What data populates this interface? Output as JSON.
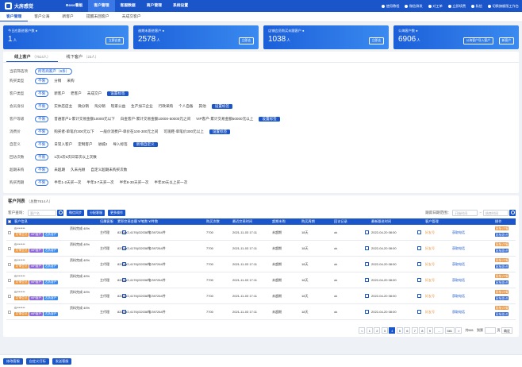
{
  "app": {
    "title": "大房感觉"
  },
  "nav": {
    "items": [
      "Boss看板",
      "客户管理",
      "客服数据",
      "商户管理",
      "系统设置"
    ]
  },
  "topright": {
    "items": [
      "使用教程",
      "微信群发",
      "对工单",
      "立即续费",
      "私信",
      "切换旗舰版工作台"
    ]
  },
  "subtabs": [
    "客户管理",
    "客户公海",
    "新客户",
    "提醒未回客户",
    "未成交客户"
  ],
  "stats": [
    {
      "label": "今日应跟进客户数 ●",
      "value": "1",
      "unit": "人",
      "button": "立即去查"
    },
    {
      "label": "逾期未跟进客户 ●",
      "value": "2578",
      "unit": "人",
      "button": "立即去"
    },
    {
      "label": "店铺会员购买未跟客户 ●",
      "value": "1038",
      "unit": "人",
      "button": "立即去"
    },
    {
      "label": "公海客户数 ●",
      "value": "6906",
      "unit": "人",
      "button": "公海客户导入客户",
      "button2": "新客户"
    }
  ],
  "filter": {
    "tabs": [
      {
        "label": "线上客户",
        "count": "（7614人）"
      },
      {
        "label": "线下客户",
        "count": "（23人）"
      }
    ],
    "rows": [
      {
        "key": "当前筛选项",
        "opts": [
          "所有商家产（6条）"
        ]
      },
      {
        "key": "购买类型",
        "opts": [
          "不限",
          "分销",
          "采购"
        ]
      },
      {
        "key": "客户类型",
        "opts": [
          "不限",
          "新客户",
          "老客户",
          "未成交户",
          "设置标签"
        ]
      },
      {
        "key": "会员身份",
        "opts": [
          "不限",
          "实体店店主",
          "微分销",
          "淘分销",
          "现家公益",
          "生产加工企业",
          "行政采购",
          "个人自备",
          "其他",
          "设置标签"
        ]
      },
      {
        "key": "客户等级",
        "opts": [
          "不限",
          "普通客户1-累计交易金额10000元以下",
          "白金客户-累计交易金额10000-50000元之间",
          "VIP客户-累计交易金额50000元以上",
          "设置标签"
        ]
      },
      {
        "key": "消费价",
        "opts": [
          "不限",
          "购买者-单笔价300元以下",
          "一般价消费户-单价在100-300元之间",
          "可观鞋-单笔价300元以上",
          "设置标签"
        ]
      },
      {
        "key": "自定义",
        "opts": [
          "不限",
          "日常入客户",
          "定制客户",
          "进城2",
          "导入标签",
          "新增自定义"
        ]
      },
      {
        "key": "回访次数",
        "opts": [
          "不限",
          "1次3次5次日常次以上次数"
        ]
      },
      {
        "key": "超期未购",
        "opts": [
          "不限",
          "未超期",
          "久未光顾",
          "自定义超期未购买次数"
        ]
      },
      {
        "key": "购买周期",
        "opts": [
          "不限",
          "半年1-2天买一次",
          "半年3-7天买一次",
          "半年8-30天买一次",
          "半年30天以上买一次"
        ]
      }
    ]
  },
  "list": {
    "title": "客户列表",
    "count": "（总数7614人）",
    "search_label": "客户查询：",
    "search_placeholder": "客户名",
    "btn_sync": "微信同步",
    "btn_group": "分配客服",
    "btn_more": "更多操作",
    "date_label": "跟踪日期范围：",
    "date_from": "开始时间",
    "date_to": "结束时间",
    "columns": [
      "客户信息",
      "归属客服",
      "累积交易金额 ¥/笔数 ¥/件数",
      "购买次数",
      "最近交易时间",
      "超期未购",
      "购买周期",
      "回访记录",
      "最新跟进时间",
      "客户管理",
      "操作"
    ],
    "rows": [
      {
        "name": "S*******",
        "tags": [
          "店铺会员",
          "VIP客户",
          "活跃客户"
        ],
        "score": "资料完成 40%",
        "owner": "主代理",
        "amount": "8200(¥2,4176)/32038笔/397264件",
        "times": "7700",
        "last": "2021-11-03 17:11",
        "overdue": "未超期",
        "cycle": "18天",
        "visit": "ok",
        "follow": "2022-04-20 08:00",
        "wx": "好友号",
        "phone": "获取电话",
        "op1": "客服详情",
        "op2": "客服跟进"
      },
      {
        "name": "S*******",
        "tags": [
          "店铺会员",
          "VIP客户",
          "活跃客户"
        ],
        "score": "资料完成 40%",
        "owner": "主代理",
        "amount": "8200(¥2,4176)/32038笔/397264件",
        "times": "7700",
        "last": "2021-11-03 17:11",
        "overdue": "未超期",
        "cycle": "18天",
        "visit": "ok",
        "follow": "2022-04-20 08:00",
        "wx": "好友号",
        "phone": "获取电话",
        "op1": "客服详情",
        "op2": "客服跟进"
      },
      {
        "name": "S*******",
        "tags": [
          "店铺会员",
          "VIP客户",
          "活跃客户"
        ],
        "score": "资料完成 40%",
        "owner": "主代理",
        "amount": "8200(¥2,4176)/32038笔/397264件",
        "times": "7700",
        "last": "2021-11-03 17:11",
        "overdue": "未超期",
        "cycle": "18天",
        "visit": "ok",
        "follow": "2022-04-20 08:00",
        "wx": "好友号",
        "phone": "获取电话",
        "op1": "客服详情",
        "op2": "客服跟进"
      },
      {
        "name": "S*******",
        "tags": [
          "店铺会员",
          "VIP客户",
          "活跃客户"
        ],
        "score": "资料完成 40%",
        "owner": "主代理",
        "amount": "8200(¥2,4176)/32038笔/397264件",
        "times": "7700",
        "last": "2021-11-03 17:11",
        "overdue": "未超期",
        "cycle": "18天",
        "visit": "ok",
        "follow": "2022-04-20 08:00",
        "wx": "好友号",
        "phone": "获取电话",
        "op1": "客服详情",
        "op2": "客服跟进"
      },
      {
        "name": "S*******",
        "tags": [
          "店铺会员",
          "VIP客户",
          "活跃客户"
        ],
        "score": "资料完成 40%",
        "owner": "主代理",
        "amount": "8200(¥2,4176)/32038笔/397264件",
        "times": "7700",
        "last": "2021-11-03 17:11",
        "overdue": "未超期",
        "cycle": "18天",
        "visit": "ok",
        "follow": "2022-04-20 08:00",
        "wx": "好友号",
        "phone": "获取电话",
        "op1": "客服详情",
        "op2": "客服跟进"
      },
      {
        "name": "S*******",
        "tags": [
          "店铺会员",
          "VIP客户",
          "活跃客户"
        ],
        "score": "资料完成 40%",
        "owner": "主代理",
        "amount": "8200(¥2,4176)/32038笔/397264件",
        "times": "7700",
        "last": "2021-11-03 17:11",
        "overdue": "未超期",
        "cycle": "18天",
        "visit": "ok",
        "follow": "2022-04-20 08:00",
        "wx": "好友号",
        "phone": "获取电话",
        "op1": "客服详情",
        "op2": "客服跟进"
      }
    ],
    "pager": {
      "pages": [
        "<",
        "1",
        "2",
        "3",
        "4",
        "5",
        "6",
        "7",
        "8",
        "9",
        "...",
        "581",
        ">"
      ],
      "current": "4",
      "total": "共581",
      "goto": "到第",
      "page_unit": "页",
      "confirm": "确定"
    }
  },
  "bottom": {
    "buttons": [
      "修改客服",
      "自定义打标",
      "发送客服"
    ]
  }
}
